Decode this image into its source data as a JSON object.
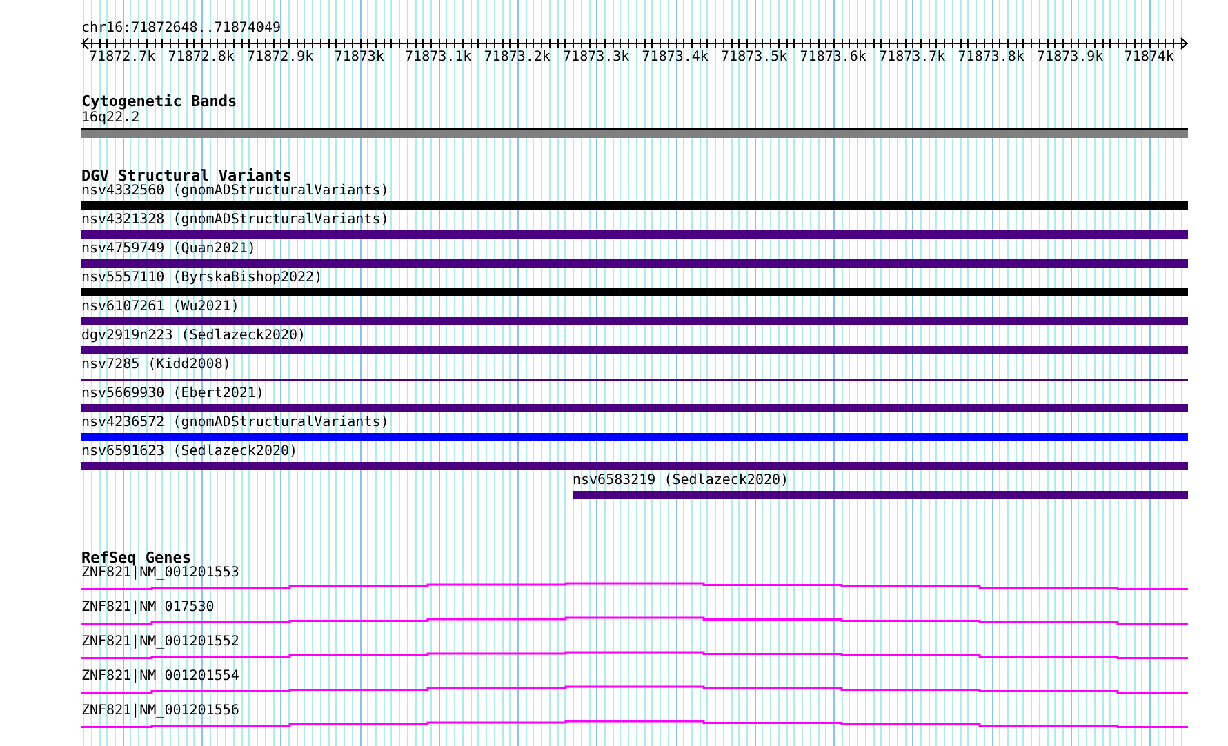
{
  "location": "chr16:71872648..71874049",
  "ruler": {
    "ticks": [
      "71872.7k",
      "71872.8k",
      "71872.9k",
      "71873k",
      "71873.1k",
      "71873.2k",
      "71873.3k",
      "71873.4k",
      "71873.5k",
      "71873.6k",
      "71873.7k",
      "71873.8k",
      "71873.9k",
      "71874k"
    ]
  },
  "tracks": [
    {
      "kind": "cytoband",
      "title": "Cytogenetic Bands",
      "features": [
        {
          "label": "16q22.2"
        }
      ]
    },
    {
      "kind": "variants",
      "title": "DGV Structural Variants",
      "features": [
        {
          "label": "nsv4332560 (gnomADStructuralVariants)",
          "color": "#000000",
          "kind": "full"
        },
        {
          "label": "nsv4321328 (gnomADStructuralVariants)",
          "color": "#4b0082",
          "kind": "full"
        },
        {
          "label": "nsv4759749 (Quan2021)",
          "color": "#4b0082",
          "kind": "full"
        },
        {
          "label": "nsv5557110 (ByrskaBishop2022)",
          "color": "#000000",
          "kind": "full"
        },
        {
          "label": "nsv6107261 (Wu2021)",
          "color": "#4b0082",
          "kind": "full"
        },
        {
          "label": "dgv2919n223 (Sedlazeck2020)",
          "color": "#4b0082",
          "kind": "full"
        },
        {
          "label": "nsv7285 (Kidd2008)",
          "color": "#4b0082",
          "kind": "thin"
        },
        {
          "label": "nsv5669930 (Ebert2021)",
          "color": "#4b0082",
          "kind": "full"
        },
        {
          "label": "nsv4236572 (gnomADStructuralVariants)",
          "color": "#0000ff",
          "kind": "full"
        },
        {
          "label": "nsv6591623 (Sedlazeck2020)",
          "color": "#4b0082",
          "kind": "full"
        },
        {
          "label": "nsv6583219 (Sedlazeck2020)",
          "color": "#4b0082",
          "kind": "tail"
        }
      ]
    },
    {
      "kind": "genes",
      "title": "RefSeq Genes",
      "features": [
        {
          "label": "ZNF821|NM_001201553"
        },
        {
          "label": "ZNF821|NM_017530"
        },
        {
          "label": "ZNF821|NM_001201552"
        },
        {
          "label": "ZNF821|NM_001201554"
        },
        {
          "label": "ZNF821|NM_001201556"
        }
      ]
    }
  ]
}
